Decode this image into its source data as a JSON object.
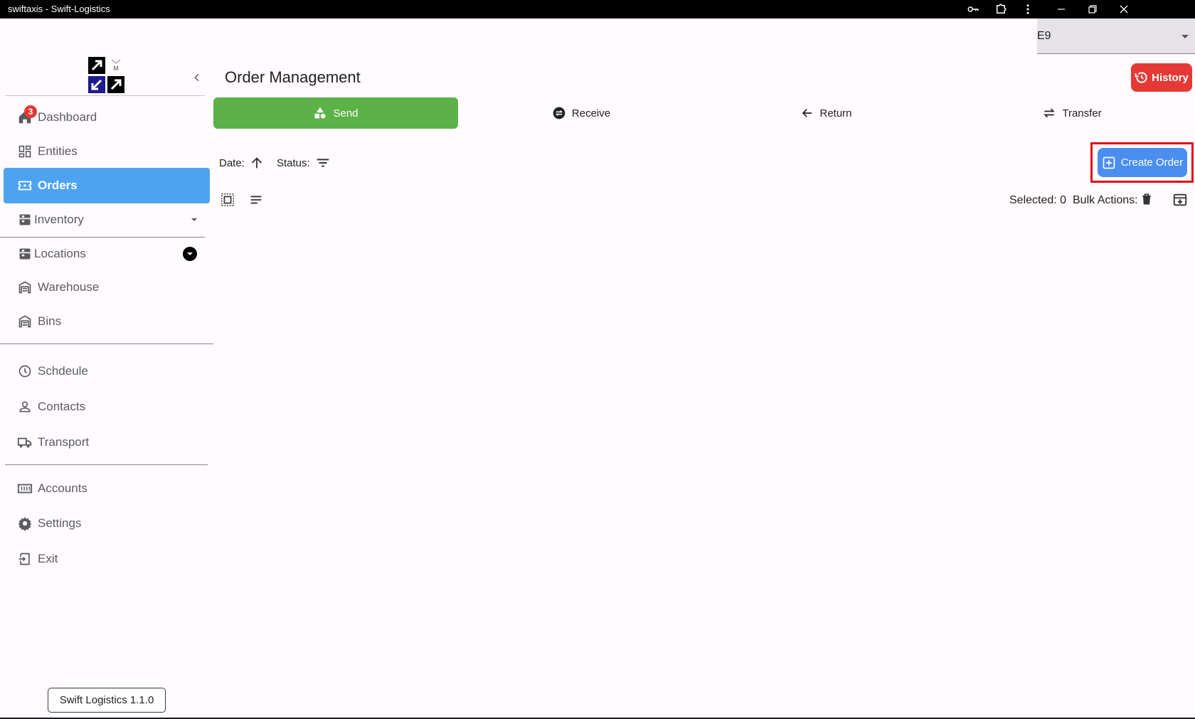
{
  "window": {
    "title": "swiftaxis - Swift-Logistics"
  },
  "sidebar": {
    "items": [
      {
        "label": "Dashboard",
        "badge": "3"
      },
      {
        "label": "Entities"
      },
      {
        "label": "Orders"
      },
      {
        "label": "Inventory"
      },
      {
        "label": "Locations"
      },
      {
        "label": "Warehouse"
      },
      {
        "label": "Bins"
      },
      {
        "label": "Schdeule"
      },
      {
        "label": "Contacts"
      },
      {
        "label": "Transport"
      },
      {
        "label": "Accounts"
      },
      {
        "label": "Settings"
      },
      {
        "label": "Exit"
      }
    ],
    "version": "Swift Logistics 1.1.0"
  },
  "header": {
    "title": "Order Management",
    "selector_value": "E9",
    "history_label": "History"
  },
  "tabs": [
    {
      "label": "Send"
    },
    {
      "label": "Receive"
    },
    {
      "label": "Return"
    },
    {
      "label": "Transfer"
    }
  ],
  "filters": {
    "date_label": "Date:",
    "status_label": "Status:"
  },
  "toolbar": {
    "create_label": "Create Order",
    "selected_text": "Selected: 0",
    "bulk_label": "Bulk Actions:"
  },
  "colors": {
    "active_nav": "#4ea3f1",
    "send_tab": "#5cb247",
    "history": "#e53935",
    "create": "#4a8ef0",
    "highlight": "#e0101c"
  }
}
